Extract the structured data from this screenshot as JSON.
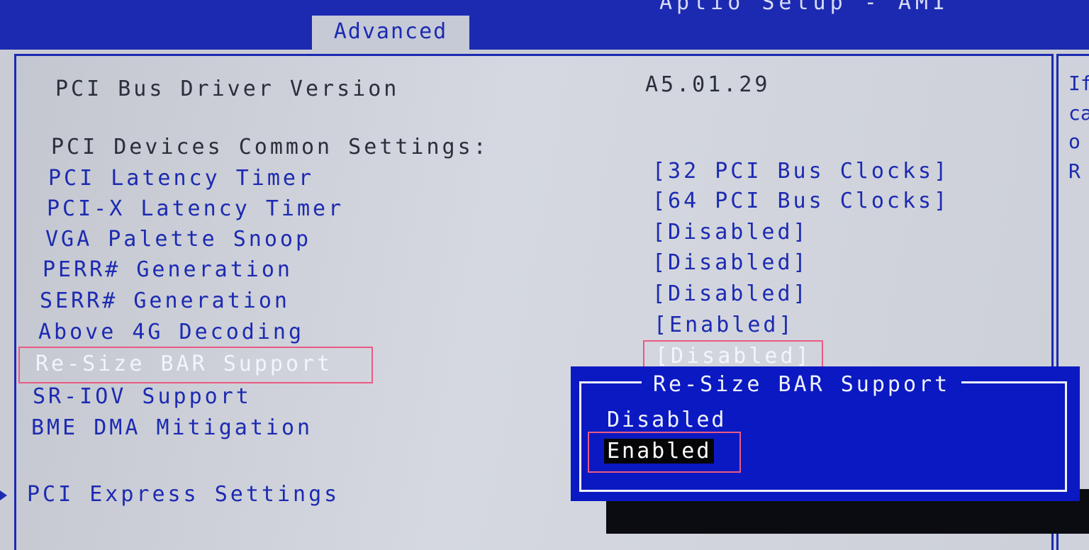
{
  "header": {
    "app_title": "Aptio Setup - AMI",
    "active_tab": "Advanced"
  },
  "help": {
    "lines": [
      "If",
      "ca",
      "o",
      "R"
    ]
  },
  "settings": {
    "driver_version_label": "PCI Bus Driver Version",
    "driver_version_value": "A5.01.29",
    "section_title": "PCI Devices Common Settings:",
    "items": [
      {
        "label": "PCI Latency Timer",
        "value": "[32 PCI Bus Clocks]"
      },
      {
        "label": "PCI-X Latency Timer",
        "value": "[64 PCI Bus Clocks]"
      },
      {
        "label": "VGA Palette Snoop",
        "value": "[Disabled]"
      },
      {
        "label": "PERR# Generation",
        "value": "[Disabled]"
      },
      {
        "label": "SERR# Generation",
        "value": "[Disabled]"
      },
      {
        "label": "Above 4G Decoding",
        "value": "[Enabled]"
      },
      {
        "label": "Re-Size BAR Support",
        "value": "[Disabled]"
      },
      {
        "label": "SR-IOV Support",
        "value": ""
      },
      {
        "label": "BME DMA Mitigation",
        "value": ""
      }
    ],
    "submenu": "PCI Express Settings"
  },
  "popup": {
    "title": "Re-Size BAR Support",
    "options": [
      "Disabled",
      "Enabled"
    ],
    "selected": "Enabled"
  },
  "colors": {
    "bios_blue": "#1c2ab2",
    "popup_blue": "#0b19c2",
    "highlight_pink": "#ea5a84"
  }
}
